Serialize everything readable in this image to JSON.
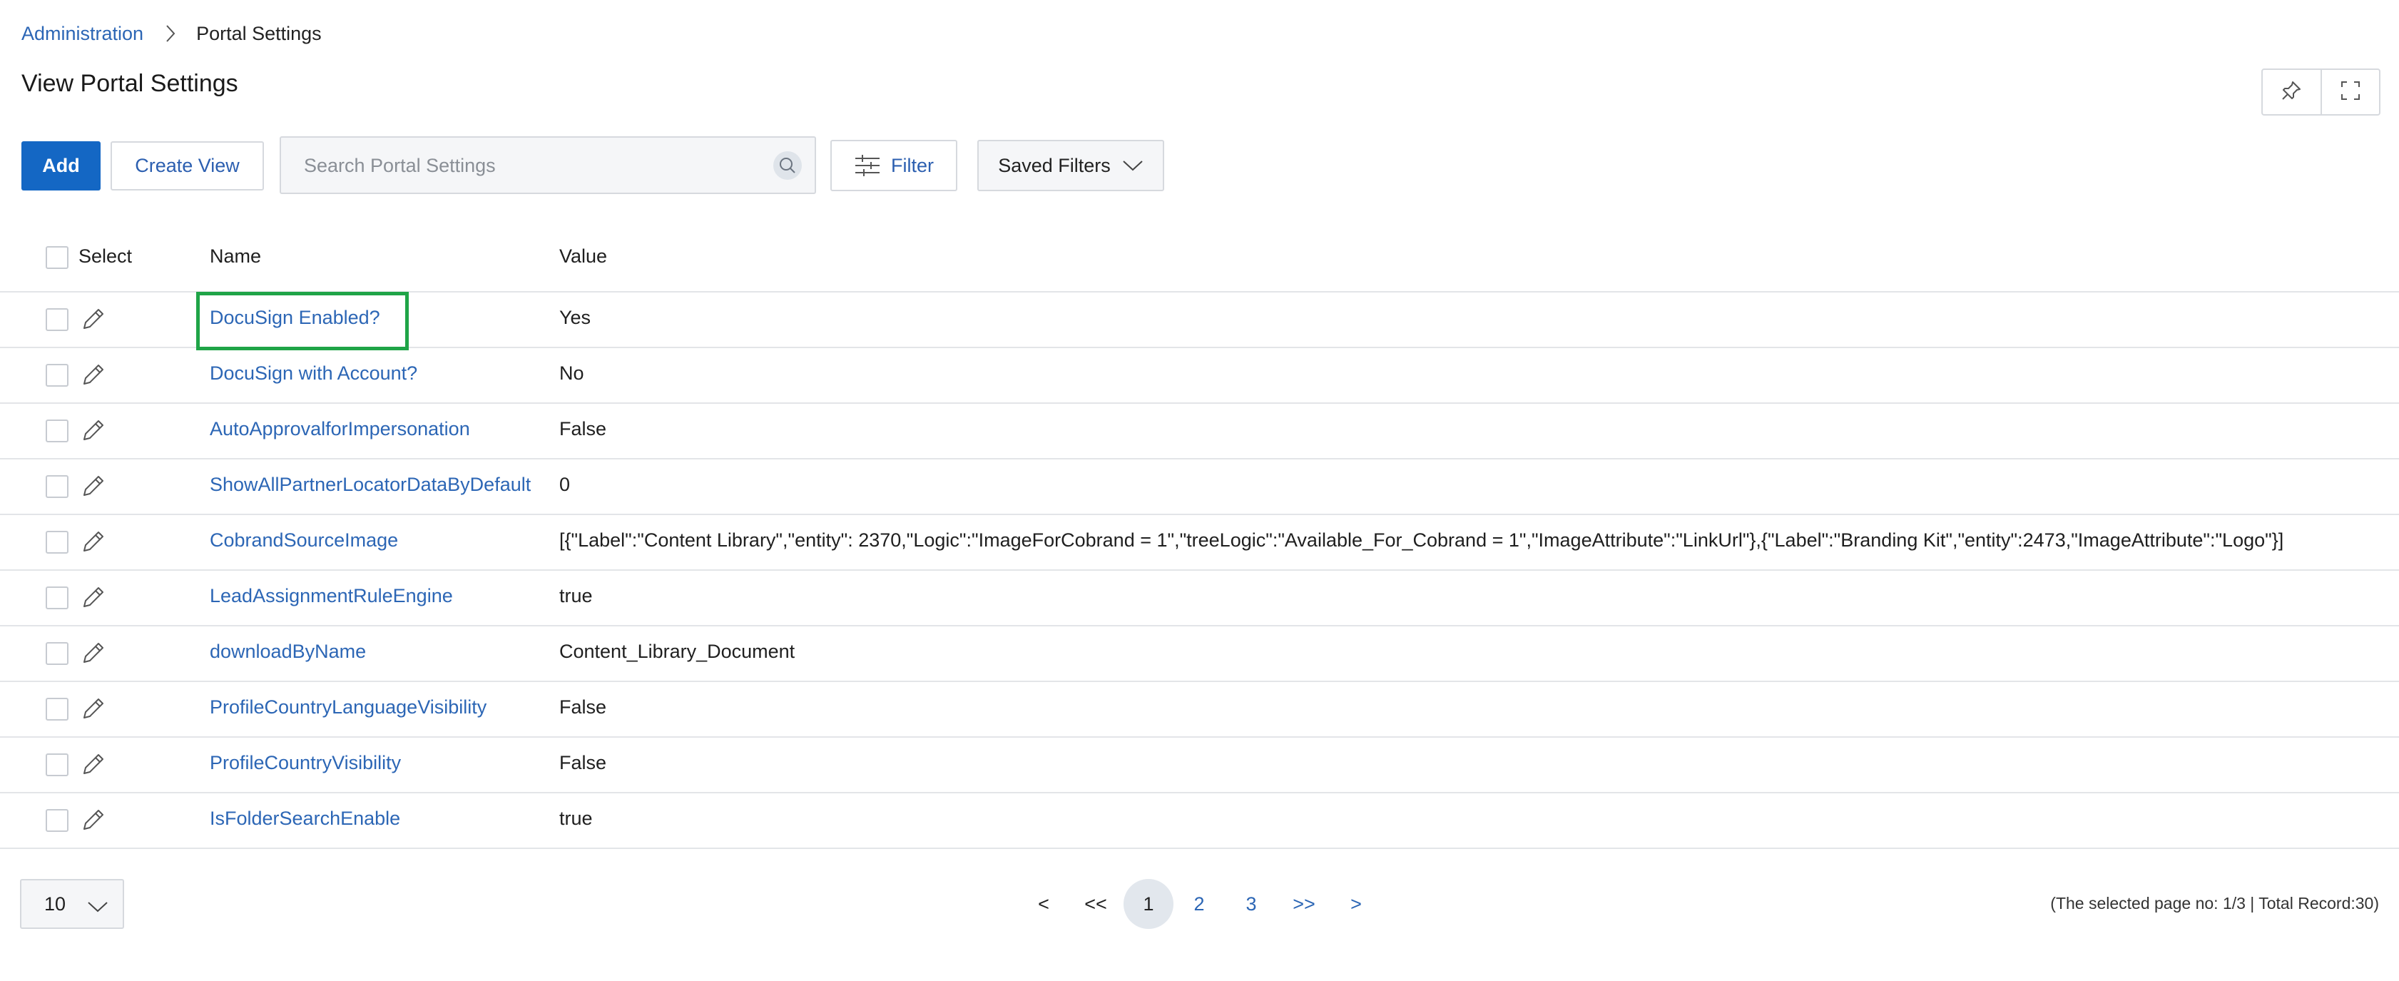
{
  "breadcrumb": {
    "parent": "Administration",
    "current": "Portal Settings"
  },
  "page_title": "View Portal Settings",
  "toolbar": {
    "add_label": "Add",
    "create_view_label": "Create View",
    "search_placeholder": "Search Portal Settings",
    "filter_label": "Filter",
    "saved_filters_label": "Saved Filters"
  },
  "table": {
    "columns": {
      "select": "Select",
      "name": "Name",
      "value": "Value"
    },
    "rows": [
      {
        "name": "DocuSign Enabled?",
        "value": "Yes"
      },
      {
        "name": "DocuSign with Account?",
        "value": "No"
      },
      {
        "name": "AutoApprovalforImpersonation",
        "value": "False"
      },
      {
        "name": "ShowAllPartnerLocatorDataByDefault",
        "value": "0"
      },
      {
        "name": "CobrandSourceImage",
        "value": "[{\"Label\":\"Content Library\",\"entity\": 2370,\"Logic\":\"ImageForCobrand = 1\",\"treeLogic\":\"Available_For_Cobrand = 1\",\"ImageAttribute\":\"LinkUrl\"},{\"Label\":\"Branding Kit\",\"entity\":2473,\"ImageAttribute\":\"Logo\"}]"
      },
      {
        "name": "LeadAssignmentRuleEngine",
        "value": "true"
      },
      {
        "name": "downloadByName",
        "value": "Content_Library_Document"
      },
      {
        "name": "ProfileCountryLanguageVisibility",
        "value": "False"
      },
      {
        "name": "ProfileCountryVisibility",
        "value": "False"
      },
      {
        "name": "IsFolderSearchEnable",
        "value": "true"
      }
    ]
  },
  "footer": {
    "page_size": "10",
    "pagination": {
      "prev": "<",
      "first": "<<",
      "pages": [
        "1",
        "2",
        "3"
      ],
      "last": ">>",
      "next": ">"
    },
    "status": "(The selected page no: 1/3 | Total Record:30)"
  },
  "colors": {
    "primary": "#1467c4",
    "link": "#2c66b5",
    "highlight": "#1fa447",
    "border": "#d6d9de"
  }
}
